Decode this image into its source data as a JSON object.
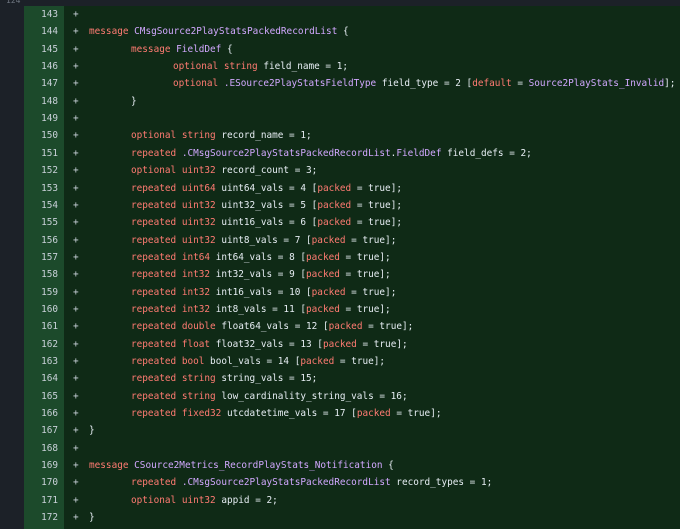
{
  "diff": {
    "prev_old_line": "124",
    "prev_new_line": "143",
    "sign": "+",
    "lines": [
      {
        "n": "143",
        "indent": "",
        "segments": []
      },
      {
        "n": "144",
        "indent": "",
        "segments": [
          {
            "t": "message ",
            "c": "kw"
          },
          {
            "t": "CMsgSource2PlayStatsPackedRecordList",
            "c": "nm"
          },
          {
            "t": " {",
            "c": "plain"
          }
        ]
      },
      {
        "n": "145",
        "indent": "\t",
        "segments": [
          {
            "t": "message ",
            "c": "kw"
          },
          {
            "t": "FieldDef",
            "c": "nm"
          },
          {
            "t": " {",
            "c": "plain"
          }
        ]
      },
      {
        "n": "146",
        "indent": "\t\t",
        "segments": [
          {
            "t": "optional ",
            "c": "kw"
          },
          {
            "t": "string ",
            "c": "kw"
          },
          {
            "t": "field_name = ",
            "c": "plain"
          },
          {
            "t": "1",
            "c": "plain"
          },
          {
            "t": ";",
            "c": "plain"
          }
        ]
      },
      {
        "n": "147",
        "indent": "\t\t",
        "segments": [
          {
            "t": "optional ",
            "c": "kw"
          },
          {
            "t": ".ESource2PlayStatsFieldType ",
            "c": "nm"
          },
          {
            "t": "field_type = ",
            "c": "plain"
          },
          {
            "t": "2",
            "c": "plain"
          },
          {
            "t": " [",
            "c": "plain"
          },
          {
            "t": "default",
            "c": "kw"
          },
          {
            "t": " = ",
            "c": "plain"
          },
          {
            "t": "Source2PlayStats_Invalid",
            "c": "nm"
          },
          {
            "t": "];",
            "c": "plain"
          }
        ]
      },
      {
        "n": "148",
        "indent": "\t",
        "segments": [
          {
            "t": "}",
            "c": "plain"
          }
        ]
      },
      {
        "n": "149",
        "indent": "",
        "segments": []
      },
      {
        "n": "150",
        "indent": "\t",
        "segments": [
          {
            "t": "optional ",
            "c": "kw"
          },
          {
            "t": "string ",
            "c": "kw"
          },
          {
            "t": "record_name = ",
            "c": "plain"
          },
          {
            "t": "1",
            "c": "plain"
          },
          {
            "t": ";",
            "c": "plain"
          }
        ]
      },
      {
        "n": "151",
        "indent": "\t",
        "segments": [
          {
            "t": "repeated ",
            "c": "kw"
          },
          {
            "t": ".CMsgSource2PlayStatsPackedRecordList",
            "c": "nm"
          },
          {
            "t": ".",
            "c": "plain"
          },
          {
            "t": "FieldDef",
            "c": "nm"
          },
          {
            "t": " field_defs = ",
            "c": "plain"
          },
          {
            "t": "2",
            "c": "plain"
          },
          {
            "t": ";",
            "c": "plain"
          }
        ]
      },
      {
        "n": "152",
        "indent": "\t",
        "segments": [
          {
            "t": "optional ",
            "c": "kw"
          },
          {
            "t": "uint32 ",
            "c": "kw"
          },
          {
            "t": "record_count = ",
            "c": "plain"
          },
          {
            "t": "3",
            "c": "plain"
          },
          {
            "t": ";",
            "c": "plain"
          }
        ]
      },
      {
        "n": "153",
        "indent": "\t",
        "segments": [
          {
            "t": "repeated ",
            "c": "kw"
          },
          {
            "t": "uint64 ",
            "c": "kw"
          },
          {
            "t": "uint64_vals = ",
            "c": "plain"
          },
          {
            "t": "4",
            "c": "plain"
          },
          {
            "t": " [",
            "c": "plain"
          },
          {
            "t": "packed",
            "c": "kw"
          },
          {
            "t": " = ",
            "c": "plain"
          },
          {
            "t": "true",
            "c": "plain"
          },
          {
            "t": "];",
            "c": "plain"
          }
        ]
      },
      {
        "n": "154",
        "indent": "\t",
        "segments": [
          {
            "t": "repeated ",
            "c": "kw"
          },
          {
            "t": "uint32 ",
            "c": "kw"
          },
          {
            "t": "uint32_vals = ",
            "c": "plain"
          },
          {
            "t": "5",
            "c": "plain"
          },
          {
            "t": " [",
            "c": "plain"
          },
          {
            "t": "packed",
            "c": "kw"
          },
          {
            "t": " = ",
            "c": "plain"
          },
          {
            "t": "true",
            "c": "plain"
          },
          {
            "t": "];",
            "c": "plain"
          }
        ]
      },
      {
        "n": "155",
        "indent": "\t",
        "segments": [
          {
            "t": "repeated ",
            "c": "kw"
          },
          {
            "t": "uint32 ",
            "c": "kw"
          },
          {
            "t": "uint16_vals = ",
            "c": "plain"
          },
          {
            "t": "6",
            "c": "plain"
          },
          {
            "t": " [",
            "c": "plain"
          },
          {
            "t": "packed",
            "c": "kw"
          },
          {
            "t": " = ",
            "c": "plain"
          },
          {
            "t": "true",
            "c": "plain"
          },
          {
            "t": "];",
            "c": "plain"
          }
        ]
      },
      {
        "n": "156",
        "indent": "\t",
        "segments": [
          {
            "t": "repeated ",
            "c": "kw"
          },
          {
            "t": "uint32 ",
            "c": "kw"
          },
          {
            "t": "uint8_vals = ",
            "c": "plain"
          },
          {
            "t": "7",
            "c": "plain"
          },
          {
            "t": " [",
            "c": "plain"
          },
          {
            "t": "packed",
            "c": "kw"
          },
          {
            "t": " = ",
            "c": "plain"
          },
          {
            "t": "true",
            "c": "plain"
          },
          {
            "t": "];",
            "c": "plain"
          }
        ]
      },
      {
        "n": "157",
        "indent": "\t",
        "segments": [
          {
            "t": "repeated ",
            "c": "kw"
          },
          {
            "t": "int64 ",
            "c": "kw"
          },
          {
            "t": "int64_vals = ",
            "c": "plain"
          },
          {
            "t": "8",
            "c": "plain"
          },
          {
            "t": " [",
            "c": "plain"
          },
          {
            "t": "packed",
            "c": "kw"
          },
          {
            "t": " = ",
            "c": "plain"
          },
          {
            "t": "true",
            "c": "plain"
          },
          {
            "t": "];",
            "c": "plain"
          }
        ]
      },
      {
        "n": "158",
        "indent": "\t",
        "segments": [
          {
            "t": "repeated ",
            "c": "kw"
          },
          {
            "t": "int32 ",
            "c": "kw"
          },
          {
            "t": "int32_vals = ",
            "c": "plain"
          },
          {
            "t": "9",
            "c": "plain"
          },
          {
            "t": " [",
            "c": "plain"
          },
          {
            "t": "packed",
            "c": "kw"
          },
          {
            "t": " = ",
            "c": "plain"
          },
          {
            "t": "true",
            "c": "plain"
          },
          {
            "t": "];",
            "c": "plain"
          }
        ]
      },
      {
        "n": "159",
        "indent": "\t",
        "segments": [
          {
            "t": "repeated ",
            "c": "kw"
          },
          {
            "t": "int32 ",
            "c": "kw"
          },
          {
            "t": "int16_vals = ",
            "c": "plain"
          },
          {
            "t": "10",
            "c": "plain"
          },
          {
            "t": " [",
            "c": "plain"
          },
          {
            "t": "packed",
            "c": "kw"
          },
          {
            "t": " = ",
            "c": "plain"
          },
          {
            "t": "true",
            "c": "plain"
          },
          {
            "t": "];",
            "c": "plain"
          }
        ]
      },
      {
        "n": "160",
        "indent": "\t",
        "segments": [
          {
            "t": "repeated ",
            "c": "kw"
          },
          {
            "t": "int32 ",
            "c": "kw"
          },
          {
            "t": "int8_vals = ",
            "c": "plain"
          },
          {
            "t": "11",
            "c": "plain"
          },
          {
            "t": " [",
            "c": "plain"
          },
          {
            "t": "packed",
            "c": "kw"
          },
          {
            "t": " = ",
            "c": "plain"
          },
          {
            "t": "true",
            "c": "plain"
          },
          {
            "t": "];",
            "c": "plain"
          }
        ]
      },
      {
        "n": "161",
        "indent": "\t",
        "segments": [
          {
            "t": "repeated ",
            "c": "kw"
          },
          {
            "t": "double ",
            "c": "kw"
          },
          {
            "t": "float64_vals = ",
            "c": "plain"
          },
          {
            "t": "12",
            "c": "plain"
          },
          {
            "t": " [",
            "c": "plain"
          },
          {
            "t": "packed",
            "c": "kw"
          },
          {
            "t": " = ",
            "c": "plain"
          },
          {
            "t": "true",
            "c": "plain"
          },
          {
            "t": "];",
            "c": "plain"
          }
        ]
      },
      {
        "n": "162",
        "indent": "\t",
        "segments": [
          {
            "t": "repeated ",
            "c": "kw"
          },
          {
            "t": "float ",
            "c": "kw"
          },
          {
            "t": "float32_vals = ",
            "c": "plain"
          },
          {
            "t": "13",
            "c": "plain"
          },
          {
            "t": " [",
            "c": "plain"
          },
          {
            "t": "packed",
            "c": "kw"
          },
          {
            "t": " = ",
            "c": "plain"
          },
          {
            "t": "true",
            "c": "plain"
          },
          {
            "t": "];",
            "c": "plain"
          }
        ]
      },
      {
        "n": "163",
        "indent": "\t",
        "segments": [
          {
            "t": "repeated ",
            "c": "kw"
          },
          {
            "t": "bool ",
            "c": "kw"
          },
          {
            "t": "bool_vals = ",
            "c": "plain"
          },
          {
            "t": "14",
            "c": "plain"
          },
          {
            "t": " [",
            "c": "plain"
          },
          {
            "t": "packed",
            "c": "kw"
          },
          {
            "t": " = ",
            "c": "plain"
          },
          {
            "t": "true",
            "c": "plain"
          },
          {
            "t": "];",
            "c": "plain"
          }
        ]
      },
      {
        "n": "164",
        "indent": "\t",
        "segments": [
          {
            "t": "repeated ",
            "c": "kw"
          },
          {
            "t": "string ",
            "c": "kw"
          },
          {
            "t": "string_vals = ",
            "c": "plain"
          },
          {
            "t": "15",
            "c": "plain"
          },
          {
            "t": ";",
            "c": "plain"
          }
        ]
      },
      {
        "n": "165",
        "indent": "\t",
        "segments": [
          {
            "t": "repeated ",
            "c": "kw"
          },
          {
            "t": "string ",
            "c": "kw"
          },
          {
            "t": "low_cardinality_string_vals = ",
            "c": "plain"
          },
          {
            "t": "16",
            "c": "plain"
          },
          {
            "t": ";",
            "c": "plain"
          }
        ]
      },
      {
        "n": "166",
        "indent": "\t",
        "segments": [
          {
            "t": "repeated ",
            "c": "kw"
          },
          {
            "t": "fixed32 ",
            "c": "kw"
          },
          {
            "t": "utcdatetime_vals = ",
            "c": "plain"
          },
          {
            "t": "17",
            "c": "plain"
          },
          {
            "t": " [",
            "c": "plain"
          },
          {
            "t": "packed",
            "c": "kw"
          },
          {
            "t": " = ",
            "c": "plain"
          },
          {
            "t": "true",
            "c": "plain"
          },
          {
            "t": "];",
            "c": "plain"
          }
        ]
      },
      {
        "n": "167",
        "indent": "",
        "segments": [
          {
            "t": "}",
            "c": "plain"
          }
        ]
      },
      {
        "n": "168",
        "indent": "",
        "segments": []
      },
      {
        "n": "169",
        "indent": "",
        "segments": [
          {
            "t": "message ",
            "c": "kw"
          },
          {
            "t": "CSource2Metrics_RecordPlayStats_Notification",
            "c": "nm"
          },
          {
            "t": " {",
            "c": "plain"
          }
        ]
      },
      {
        "n": "170",
        "indent": "\t",
        "segments": [
          {
            "t": "repeated ",
            "c": "kw"
          },
          {
            "t": ".CMsgSource2PlayStatsPackedRecordList ",
            "c": "nm"
          },
          {
            "t": "record_types = ",
            "c": "plain"
          },
          {
            "t": "1",
            "c": "plain"
          },
          {
            "t": ";",
            "c": "plain"
          }
        ]
      },
      {
        "n": "171",
        "indent": "\t",
        "segments": [
          {
            "t": "optional ",
            "c": "kw"
          },
          {
            "t": "uint32 ",
            "c": "kw"
          },
          {
            "t": "appid = ",
            "c": "plain"
          },
          {
            "t": "2",
            "c": "plain"
          },
          {
            "t": ";",
            "c": "plain"
          }
        ]
      },
      {
        "n": "172",
        "indent": "",
        "segments": [
          {
            "t": "}",
            "c": "plain"
          }
        ]
      }
    ]
  }
}
